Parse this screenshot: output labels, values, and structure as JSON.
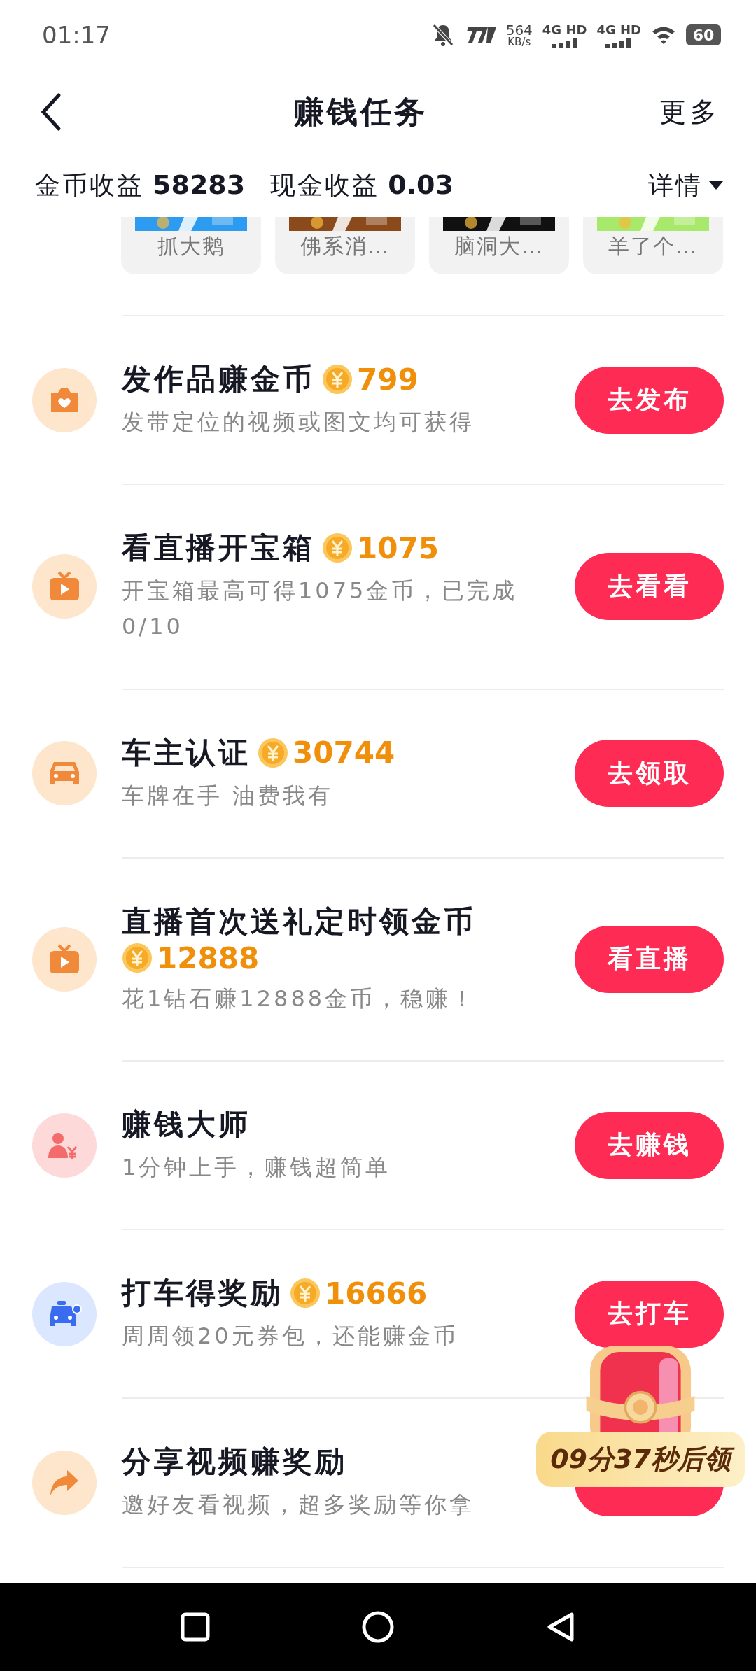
{
  "status_bar": {
    "time": "01:17",
    "net_speed": "564",
    "net_unit": "KB/s",
    "sims": [
      "4G HD",
      "4G HD"
    ],
    "battery": "60"
  },
  "header": {
    "title": "赚钱任务",
    "more": "更多"
  },
  "earnings": {
    "coin_label": "金币收益",
    "coin_value": "58283",
    "cash_label": "现金收益",
    "cash_value": "0.03",
    "details": "详情"
  },
  "games": [
    {
      "label": "抓大鹅"
    },
    {
      "label": "佛系消…"
    },
    {
      "label": "脑洞大…"
    },
    {
      "label": "羊了个…"
    }
  ],
  "tasks": [
    {
      "kind": "camera",
      "title": "发作品赚金币",
      "reward": "799",
      "subtitle": "发带定位的视频或图文均可获得",
      "action": "去发布"
    },
    {
      "kind": "tv",
      "title": "看直播开宝箱",
      "reward": "1075",
      "subtitle": "开宝箱最高可得1075金币，已完成0/10",
      "action": "去看看"
    },
    {
      "kind": "car",
      "title": "车主认证",
      "reward": "30744",
      "subtitle": "车牌在手 油费我有",
      "action": "去领取"
    },
    {
      "kind": "tv",
      "title": "直播首次送礼定时领金币",
      "reward": "12888",
      "subtitle": "花1钻石赚12888金币，稳赚！",
      "action": "看直播"
    },
    {
      "kind": "people",
      "title": "赚钱大师",
      "subtitle": "1分钟上手，赚钱超简单",
      "action": "去赚钱"
    },
    {
      "kind": "taxi",
      "title": "打车得奖励",
      "reward": "16666",
      "subtitle": "周周领20元券包，还能赚金币",
      "action": "去打车"
    },
    {
      "kind": "share",
      "title": "分享视频赚奖励",
      "subtitle": "邀好友看视频，超多奖励等你拿"
    }
  ],
  "floating_reward": {
    "countdown": "09分37秒后领"
  }
}
